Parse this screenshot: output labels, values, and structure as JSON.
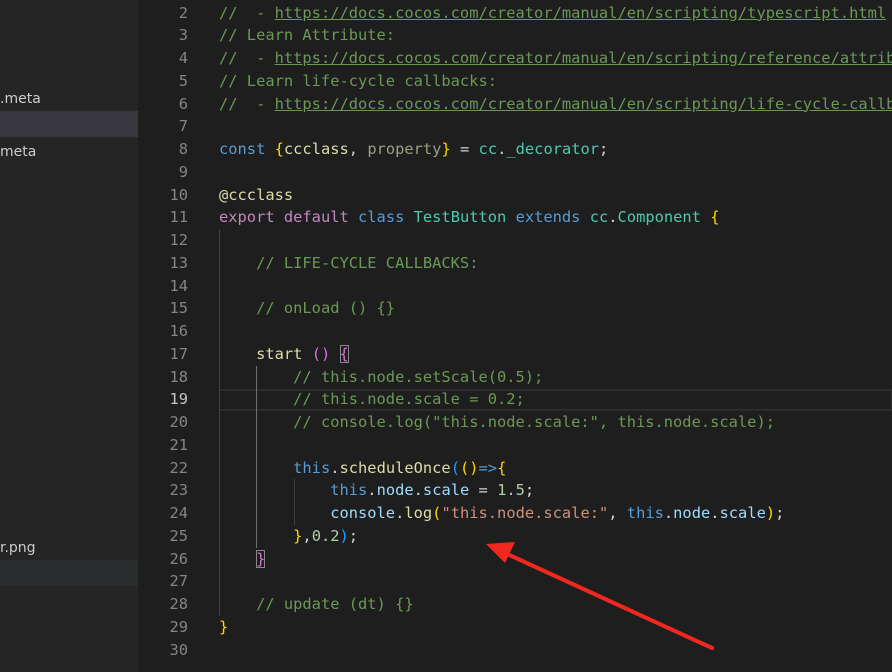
{
  "sidebar": {
    "items": [
      {
        "label": ".meta",
        "state": "normal"
      },
      {
        "label": "",
        "state": "selected"
      },
      {
        "label": "meta",
        "state": "normal"
      },
      {
        "label": "r.png",
        "state": "normal"
      },
      {
        "label": "",
        "state": "hover"
      }
    ]
  },
  "editor": {
    "current_line": 19,
    "lines": [
      {
        "n": 2,
        "t": [
          [
            "//  - ",
            "c"
          ],
          [
            "https://docs.cocos.com/creator/manual/en/scripting/typescript.html",
            "cu"
          ]
        ]
      },
      {
        "n": 3,
        "t": [
          [
            "// Learn Attribute:",
            "c"
          ]
        ]
      },
      {
        "n": 4,
        "t": [
          [
            "//  - ",
            "c"
          ],
          [
            "https://docs.cocos.com/creator/manual/en/scripting/reference/attributes.html",
            "cu"
          ]
        ]
      },
      {
        "n": 5,
        "t": [
          [
            "// Learn life-cycle callbacks:",
            "c"
          ]
        ]
      },
      {
        "n": 6,
        "t": [
          [
            "//  - ",
            "c"
          ],
          [
            "https://docs.cocos.com/creator/manual/en/scripting/life-cycle-callbacks.html",
            "cu"
          ]
        ]
      },
      {
        "n": 7,
        "t": []
      },
      {
        "n": 8,
        "t": [
          [
            "const ",
            "kw"
          ],
          [
            "{",
            "b1"
          ],
          [
            "ccclass",
            "fn"
          ],
          [
            ", ",
            "pl"
          ],
          [
            "property",
            "un"
          ],
          [
            "}",
            "b1"
          ],
          [
            " = ",
            "pl"
          ],
          [
            "cc",
            "ty"
          ],
          [
            ".",
            "pl"
          ],
          [
            "_decorator",
            "ty"
          ],
          [
            ";",
            "pl"
          ]
        ]
      },
      {
        "n": 9,
        "t": []
      },
      {
        "n": 10,
        "t": [
          [
            "@ccclass",
            "fn"
          ]
        ]
      },
      {
        "n": 11,
        "t": [
          [
            "export ",
            "kc"
          ],
          [
            "default ",
            "kc"
          ],
          [
            "class ",
            "kw"
          ],
          [
            "TestButton ",
            "ty"
          ],
          [
            "extends ",
            "kw"
          ],
          [
            "cc",
            "ty"
          ],
          [
            ".",
            "pl"
          ],
          [
            "Component ",
            "ty"
          ],
          [
            "{",
            "b1"
          ]
        ]
      },
      {
        "n": 12,
        "t": []
      },
      {
        "n": 13,
        "t": [
          [
            "    ",
            "pl"
          ],
          [
            "// LIFE-CYCLE CALLBACKS:",
            "c"
          ]
        ]
      },
      {
        "n": 14,
        "t": []
      },
      {
        "n": 15,
        "t": [
          [
            "    ",
            "pl"
          ],
          [
            "// onLoad () {}",
            "c"
          ]
        ]
      },
      {
        "n": 16,
        "t": []
      },
      {
        "n": 17,
        "t": [
          [
            "    ",
            "pl"
          ],
          [
            "start ",
            "fn"
          ],
          [
            "()",
            "b2"
          ],
          [
            " ",
            "pl"
          ],
          [
            "{",
            "b2 bm"
          ]
        ]
      },
      {
        "n": 18,
        "t": [
          [
            "        ",
            "pl"
          ],
          [
            "// this.node.setScale(0.5);",
            "c"
          ]
        ]
      },
      {
        "n": 19,
        "t": [
          [
            "        ",
            "pl"
          ],
          [
            "// this.node.scale = 0.2;",
            "c"
          ]
        ]
      },
      {
        "n": 20,
        "t": [
          [
            "        ",
            "pl"
          ],
          [
            "// console.log(\"this.node.scale:\", this.node.scale);",
            "c"
          ]
        ]
      },
      {
        "n": 21,
        "t": []
      },
      {
        "n": 22,
        "t": [
          [
            "        ",
            "pl"
          ],
          [
            "this",
            "kw"
          ],
          [
            ".",
            "pl"
          ],
          [
            "scheduleOnce",
            "fn"
          ],
          [
            "(",
            "b3"
          ],
          [
            "()",
            "b1"
          ],
          [
            "=>",
            "kw"
          ],
          [
            "{",
            "b1"
          ]
        ]
      },
      {
        "n": 23,
        "t": [
          [
            "            ",
            "pl"
          ],
          [
            "this",
            "kw"
          ],
          [
            ".",
            "pl"
          ],
          [
            "node",
            "va"
          ],
          [
            ".",
            "pl"
          ],
          [
            "scale",
            "va"
          ],
          [
            " = ",
            "pl"
          ],
          [
            "1.5",
            "nu"
          ],
          [
            ";",
            "pl"
          ]
        ]
      },
      {
        "n": 24,
        "t": [
          [
            "            ",
            "pl"
          ],
          [
            "console",
            "va"
          ],
          [
            ".",
            "pl"
          ],
          [
            "log",
            "fn"
          ],
          [
            "(",
            "b1"
          ],
          [
            "\"this.node.scale:\"",
            "st"
          ],
          [
            ", ",
            "pl"
          ],
          [
            "this",
            "kw"
          ],
          [
            ".",
            "pl"
          ],
          [
            "node",
            "va"
          ],
          [
            ".",
            "pl"
          ],
          [
            "scale",
            "va"
          ],
          [
            ")",
            "b1"
          ],
          [
            ";",
            "pl"
          ]
        ]
      },
      {
        "n": 25,
        "t": [
          [
            "        ",
            "pl"
          ],
          [
            "}",
            "b1"
          ],
          [
            ",",
            "pl"
          ],
          [
            "0.2",
            "nu"
          ],
          [
            ")",
            "b3"
          ],
          [
            ";",
            "pl"
          ]
        ]
      },
      {
        "n": 26,
        "t": [
          [
            "    ",
            "pl"
          ],
          [
            "}",
            "b2 bm"
          ]
        ]
      },
      {
        "n": 27,
        "t": []
      },
      {
        "n": 28,
        "t": [
          [
            "    ",
            "pl"
          ],
          [
            "// update (dt) {}",
            "c"
          ]
        ]
      },
      {
        "n": 29,
        "t": [
          [
            "}",
            "b1"
          ]
        ]
      },
      {
        "n": 30,
        "t": []
      }
    ]
  },
  "annotation": {
    "type": "arrow",
    "color": "#f0281e"
  }
}
